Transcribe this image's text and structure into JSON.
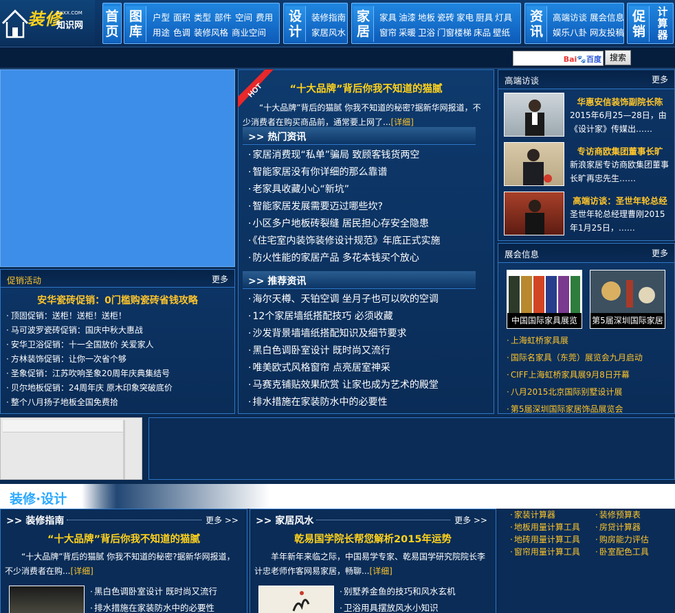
{
  "logo": {
    "main": "装修",
    "domain": "ZXXX.COM",
    "sub": "知识网"
  },
  "nav": {
    "home": "首页",
    "gallery": {
      "title": "图库",
      "row1": [
        "户型",
        "面积",
        "类型",
        "部件",
        "空间",
        "费用"
      ],
      "row2": [
        "用途",
        "色调",
        "装修风格",
        "商业空间"
      ]
    },
    "design": {
      "title": "设计",
      "row1": [
        "装修指南"
      ],
      "row2": [
        "家居风水"
      ]
    },
    "home_living": {
      "title": "家居",
      "row1": [
        "家具",
        "油漆",
        "地板",
        "瓷砖",
        "家电",
        "厨具",
        "灯具"
      ],
      "row2": [
        "窗帘",
        "采暖",
        "卫浴",
        "门窗楼梯",
        "床品",
        "壁纸"
      ]
    },
    "news": {
      "title": "资讯",
      "row1": [
        "高端访谈",
        "展会信息"
      ],
      "row2": [
        "娱乐八卦",
        "网友投稿"
      ]
    },
    "promo": "促销",
    "calculator": "计算器"
  },
  "search": {
    "baidu_label": "Bai百度",
    "button": "搜索"
  },
  "promo_panel": {
    "title": "促销活动",
    "more": "更多",
    "headline": "安华瓷砖促销：0门槛购瓷砖省钱攻略",
    "items": [
      "顶固促销：送柜！送柜！送柜！",
      "马可波罗瓷砖促销：国庆中秋大惠战",
      "安华卫浴促销：十一全国放价 关爱家人",
      "方林装饰促销：让你一次省个够",
      "圣象促销：江苏吹响圣象20周年庆典集结号",
      "贝尔地板促销：24周年庆 原木印象突破底价",
      "整个八月扬子地板全国免费拾"
    ]
  },
  "center": {
    "hot_badge": "HOT",
    "lead_title": "“十大品牌”背后你我不知道的猫腻",
    "lead_text": "“十大品牌”背后的猫腻 你我不知道的秘密?据新华网报道，不少消费者在购买商品前，通常要上网了...",
    "lead_more": "[详细]",
    "hot_head": ">> 热门资讯",
    "hot_items": [
      "家居消费现“私单”骗局 致顾客钱货两空",
      "智能家居没有你详细的那么靠谱",
      "老家具收藏小心“新坑”",
      "智能家居发展需要迈过哪些坎?",
      "小区多户地板砖裂缝 居民担心存安全隐患",
      "《住宅室内装饰装修设计规范》年底正式实施",
      "防火性能的家居产品 多花本钱买个放心"
    ],
    "rec_head": ">> 推荐资讯",
    "rec_items": [
      "海尔天樽、天铂空调 坐月子也可以吹的空调",
      "12个家居墙纸搭配技巧 必须收藏",
      "沙发背景墙墙纸搭配知识及细节要求",
      "黑白色调卧室设计 既时尚又流行",
      "唯美欧式风格窗帘 点亮居室神采",
      "马赛克铺贴效果欣赏 让家也成为艺术的殿堂",
      "排水措施在家装防水中的必要性"
    ]
  },
  "interviews": {
    "title": "高端访谈",
    "more": "更多",
    "items": [
      {
        "title": "华惠安信装饰副院长陈",
        "text": "2015年6月25—28日，由《设计家》传媒出……"
      },
      {
        "title": "专访商欧集团董事长旷",
        "text": "新浪家居专访商欧集团董事长旷再忠先生……"
      },
      {
        "title": "高端访谈：圣世年轮总经",
        "text": "圣世年轮总经理曹刚2015年1月25日，……"
      }
    ]
  },
  "expo": {
    "title": "展会信息",
    "more": "更多",
    "thumbs": [
      "中国国际家具展览",
      "第5届深圳国际家居"
    ],
    "items": [
      "上海虹桥家具展",
      "国际名家具（东莞）展览会九月启动",
      "CIFF上海虹桥家具展9月8日开幕",
      "八月2015北京国际别墅设计展",
      "第5届深圳国际家居饰品展览会"
    ]
  },
  "section": {
    "title": "装修·设计"
  },
  "guide": {
    "head": ">> 装修指南",
    "more": "更多 >>",
    "title": "“十大品牌”背后你我不知道的猫腻",
    "text": "“十大品牌”背后的猫腻 你我不知道的秘密?据新华网报道，不少消费者在购...",
    "text_more": "[详细]",
    "items": [
      "黑白色调卧室设计 既时尚又流行",
      "排水措施在家装防水中的必要性"
    ]
  },
  "fengshui": {
    "head": ">> 家居风水",
    "more": "更多 >>",
    "title": "乾易国学院长帮您解析2015年运势",
    "text": "羊年新年来临之际，中国易学专家、乾易国学研究院院长李计忠老师作客网易家居，畅聊...",
    "text_more": "[详细]",
    "items": [
      "别墅养金鱼的技巧和风水玄机",
      "卫浴用具摆放风水小知识"
    ]
  },
  "tools": {
    "col1": [
      "家装计算器",
      "地板用量计算工具",
      "地砖用量计算工具",
      "窗帘用量计算工具"
    ],
    "col2": [
      "装修预算表",
      "房贷计算器",
      "购房能力评估",
      "卧室配色工具"
    ]
  }
}
